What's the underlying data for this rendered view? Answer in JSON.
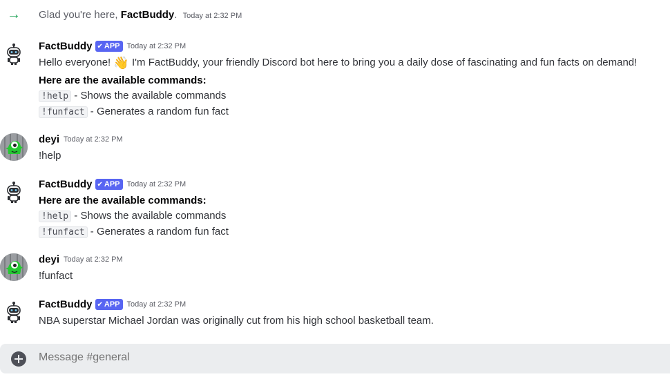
{
  "join": {
    "prefix": "Glad you're here, ",
    "name": "FactBuddy",
    "suffix": ".",
    "time": "Today at 2:32 PM"
  },
  "messages": [
    {
      "author": "FactBuddy",
      "tag": "APP",
      "time": "Today at 2:32 PM",
      "intro_before": "Hello everyone! ",
      "intro_after": " I'm FactBuddy, your friendly Discord bot here to bring you a daily dose of fascinating and fun facts on demand!",
      "heading": "Here are the available commands:",
      "commands": [
        {
          "cmd": "!help",
          "desc": " - Shows the available commands"
        },
        {
          "cmd": "!funfact",
          "desc": " - Generates a random fun fact"
        }
      ]
    },
    {
      "author": "deyi",
      "time": "Today at 2:32 PM",
      "text": "!help"
    },
    {
      "author": "FactBuddy",
      "tag": "APP",
      "time": "Today at 2:32 PM",
      "heading": "Here are the available commands:",
      "commands": [
        {
          "cmd": "!help",
          "desc": " - Shows the available commands"
        },
        {
          "cmd": "!funfact",
          "desc": " - Generates a random fun fact"
        }
      ]
    },
    {
      "author": "deyi",
      "time": "Today at 2:32 PM",
      "text": "!funfact"
    },
    {
      "author": "FactBuddy",
      "tag": "APP",
      "time": "Today at 2:32 PM",
      "text": "NBA superstar Michael Jordan was originally cut from his high school basketball team."
    }
  ],
  "composer": {
    "placeholder": "Message #general"
  },
  "icons": {
    "join": "arrow-right-icon",
    "bot_avatar": "robot-icon",
    "user_avatar": "green-alien-icon",
    "wave": "waving-hand-emoji",
    "composer_add": "plus-circle-icon"
  },
  "colors": {
    "accent": "#5865f2",
    "join_arrow": "#23a55a"
  }
}
